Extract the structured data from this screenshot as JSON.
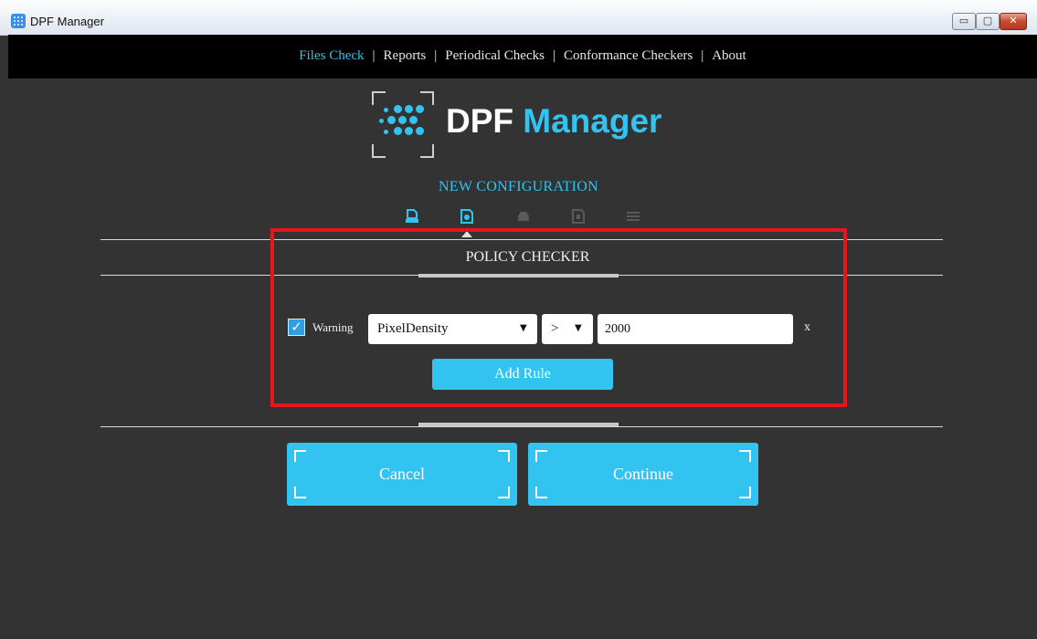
{
  "window": {
    "title": "DPF Manager",
    "controls": {
      "minimize": "▭",
      "maximize": "▢",
      "close": "✕"
    }
  },
  "menu": {
    "items": [
      "Files Check",
      "Reports",
      "Periodical Checks",
      "Conformance Checkers",
      "About"
    ],
    "active": "Files Check",
    "separator": "|"
  },
  "logo": {
    "word1": "DPF",
    "word2": "Manager"
  },
  "wizard": {
    "heading": "NEW CONFIGURATION",
    "steps": [
      "document-step-icon",
      "policy-step-icon",
      "inbox-step-icon",
      "code-file-step-icon",
      "list-step-icon"
    ],
    "active_step": 1
  },
  "policy": {
    "title": "POLICY CHECKER",
    "rule": {
      "warning_checked": true,
      "checkmark": "✓",
      "warning_label": "Warning",
      "property": "PixelDensity",
      "operator": ">",
      "value": "2000",
      "remove": "x"
    },
    "add_rule_label": "Add Rule"
  },
  "actions": {
    "cancel": "Cancel",
    "continue": "Continue"
  },
  "colors": {
    "accent": "#33c3f0",
    "background": "#333333",
    "menubar": "#000000",
    "highlight": "#e8141e"
  }
}
